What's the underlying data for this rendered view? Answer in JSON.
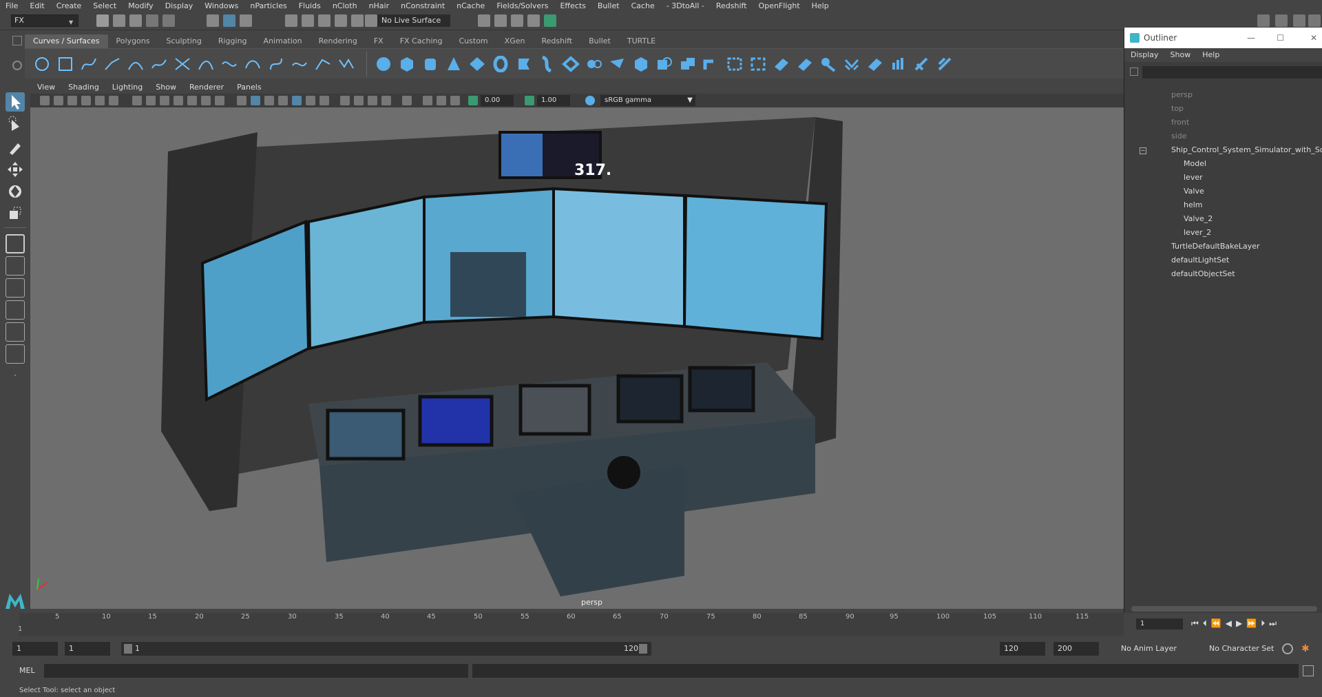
{
  "menubar": [
    "File",
    "Edit",
    "Create",
    "Select",
    "Modify",
    "Display",
    "Windows",
    "nParticles",
    "Fluids",
    "nCloth",
    "nHair",
    "nConstraint",
    "nCache",
    "Fields/Solvers",
    "Effects",
    "Bullet",
    "Cache",
    "- 3DtoAll -",
    "Redshift",
    "OpenFlight",
    "Help"
  ],
  "statusline": {
    "mode": "FX",
    "live_surface": "No Live Surface"
  },
  "shelf_tabs": [
    "Curves / Surfaces",
    "Polygons",
    "Sculpting",
    "Rigging",
    "Animation",
    "Rendering",
    "FX",
    "FX Caching",
    "Custom",
    "XGen",
    "Redshift",
    "Bullet",
    "TURTLE"
  ],
  "panel_menu": [
    "View",
    "Shading",
    "Lighting",
    "Show",
    "Renderer",
    "Panels"
  ],
  "panel_toolbar": {
    "exposure": "0.00",
    "gamma": "1.00",
    "colorspace": "sRGB gamma"
  },
  "viewport": {
    "camera": "persp",
    "screen_reading": "317."
  },
  "outliner": {
    "title": "Outliner",
    "menu": [
      "Display",
      "Show",
      "Help"
    ],
    "cameras": [
      "persp",
      "top",
      "front",
      "side"
    ],
    "group": "Ship_Control_System_Simulator_with_Screens",
    "children": [
      "Model",
      "lever",
      "Valve",
      "helm",
      "Valve_2",
      "lever_2"
    ],
    "sets": [
      "TurtleDefaultBakeLayer",
      "defaultLightSet",
      "defaultObjectSet"
    ]
  },
  "timeslider": {
    "ticks": [
      "5",
      "10",
      "15",
      "20",
      "25",
      "30",
      "35",
      "40",
      "45",
      "50",
      "55",
      "60",
      "65",
      "70",
      "75",
      "80",
      "85",
      "90",
      "95",
      "100",
      "105",
      "110",
      "115"
    ],
    "start_marker": "1",
    "current_frame": "1"
  },
  "range": {
    "start": "1",
    "playback_start": "1",
    "range_start": "1",
    "range_end_label": "120",
    "playback_end": "120",
    "end": "200",
    "anim_layer": "No Anim Layer",
    "char_set": "No Character Set"
  },
  "cmdline": {
    "lang": "MEL"
  },
  "help": "Select Tool: select an object",
  "colors": {
    "bg": "#444444",
    "viewport": "#6e6e6e",
    "accent": "#5285a6"
  }
}
